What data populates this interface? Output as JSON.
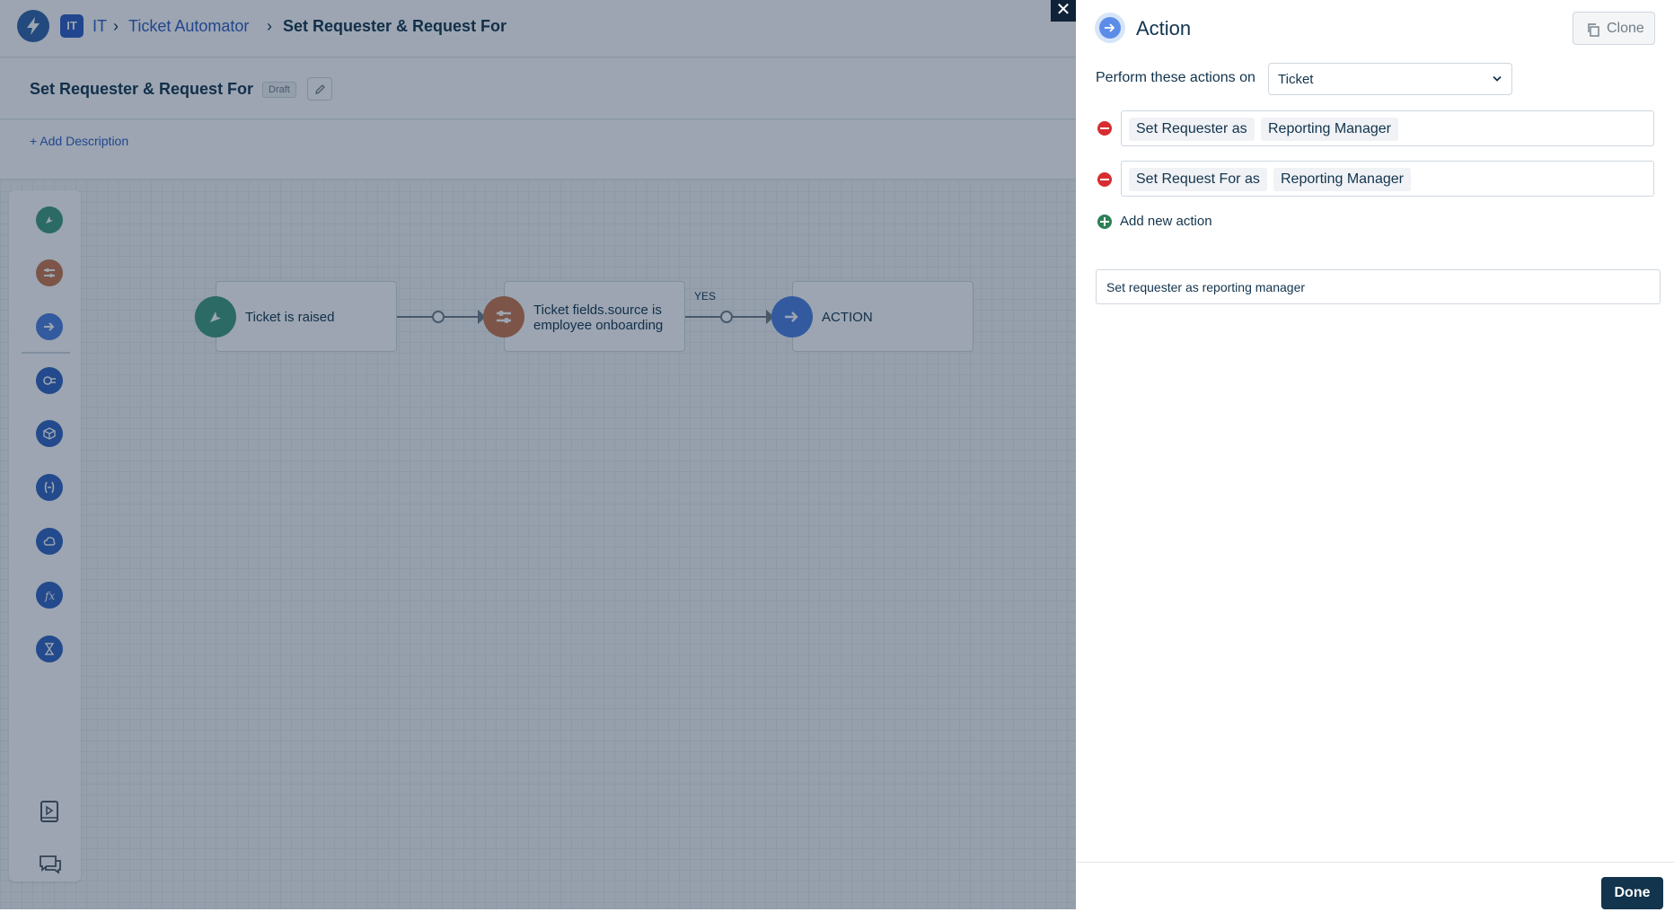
{
  "colors": {
    "brand": "#2c5cc5",
    "dark": "#12344d",
    "trigger_green": "#3f9a7f",
    "condition_orange": "#c8764a",
    "action_blue": "#4a7fe0",
    "remove_red": "#d72d30",
    "add_green": "#2b8054"
  },
  "header": {
    "breadcrumb": {
      "workspace_badge": "IT",
      "workspace": "IT",
      "section": "Ticket Automator",
      "current": "Set Requester & Request For"
    }
  },
  "workflow": {
    "title": "Set Requester & Request For",
    "status_badge": "Draft",
    "add_description": "+ Add Description"
  },
  "palette": {
    "icons": [
      "event-icon",
      "condition-icon",
      "action-icon",
      "query-icon",
      "app-icon",
      "expression-icon",
      "webhook-icon",
      "function-icon",
      "timer-icon",
      "playbook-icon",
      "feedback-icon"
    ]
  },
  "canvas": {
    "nodes": [
      {
        "type": "trigger",
        "label": "Ticket is raised",
        "icon": "event-icon"
      },
      {
        "type": "condition",
        "label_line1": "Ticket fields.source is",
        "label_line2": "employee onboarding",
        "icon": "condition-icon"
      },
      {
        "type": "action",
        "label": "ACTION",
        "icon": "action-icon"
      }
    ],
    "branch_label": "YES"
  },
  "panel": {
    "title": "Action",
    "clone_label": "Clone",
    "perform_label": "Perform these actions on",
    "perform_target": "Ticket",
    "actions": [
      {
        "field": "Set Requester as",
        "value": "Reporting Manager"
      },
      {
        "field": "Set Request For as",
        "value": "Reporting Manager"
      }
    ],
    "add_new_action": "Add new action",
    "description_value": "Set requester as reporting manager",
    "done_label": "Done"
  }
}
